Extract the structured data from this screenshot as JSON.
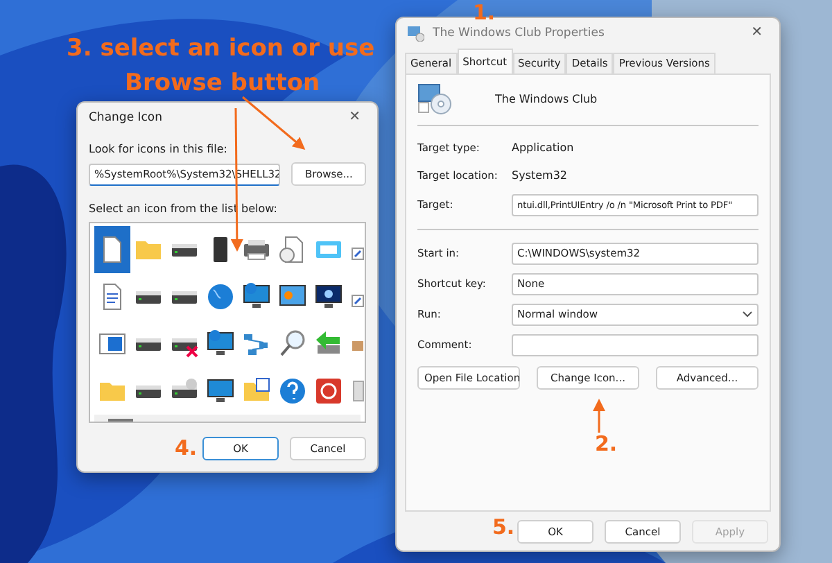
{
  "annotations": [
    {
      "text": "3. select an icon or use",
      "kind": "caption"
    },
    {
      "text": "Browse button",
      "kind": "caption"
    },
    {
      "text": "1.",
      "kind": "step"
    },
    {
      "text": "2.",
      "kind": "step"
    },
    {
      "text": "4.",
      "kind": "step"
    },
    {
      "text": "5.",
      "kind": "step"
    }
  ],
  "change_icon": {
    "title": "Change Icon",
    "close": "✕",
    "file_label": "Look for icons in this file:",
    "file_value": "%SystemRoot%\\System32\\SHELL32",
    "browse": "Browse...",
    "list_label": "Select an icon from the list below:",
    "icons": [
      {
        "selected": true
      },
      {
        "selected": false
      },
      {
        "selected": false
      },
      {
        "selected": false
      },
      {
        "selected": false
      },
      {
        "selected": false
      },
      {
        "selected": false
      },
      {
        "selected": false
      },
      {
        "selected": false
      },
      {
        "selected": false
      },
      {
        "selected": false
      },
      {
        "selected": false
      },
      {
        "selected": false
      },
      {
        "selected": false
      },
      {
        "selected": false
      },
      {
        "selected": false
      },
      {
        "selected": false
      },
      {
        "selected": false
      },
      {
        "selected": false
      },
      {
        "selected": false
      },
      {
        "selected": false
      },
      {
        "selected": false
      },
      {
        "selected": false
      },
      {
        "selected": false
      },
      {
        "selected": false
      },
      {
        "selected": false
      },
      {
        "selected": false
      },
      {
        "selected": false
      },
      {
        "selected": false
      },
      {
        "selected": false
      },
      {
        "selected": false
      },
      {
        "selected": false
      }
    ],
    "buttons": [
      {
        "label": "OK",
        "default": true
      },
      {
        "label": "Cancel",
        "default": false
      }
    ]
  },
  "properties": {
    "title": "The Windows Club Properties",
    "close": "✕",
    "tabs": [
      {
        "label": "General",
        "selected": false
      },
      {
        "label": "Shortcut",
        "selected": true
      },
      {
        "label": "Security",
        "selected": false
      },
      {
        "label": "Details",
        "selected": false
      },
      {
        "label": "Previous Versions",
        "selected": false
      }
    ],
    "shortcut_name": "The Windows Club",
    "info": [
      {
        "label": "Target type:",
        "value": "Application"
      },
      {
        "label": "Target location:",
        "value": "System32"
      }
    ],
    "target": {
      "label": "Target:",
      "value": "ntui.dll,PrintUIEntry /o /n \"Microsoft Print to PDF\""
    },
    "fields": [
      {
        "label": "Start in:",
        "value": "C:\\WINDOWS\\system32",
        "kind": "text"
      },
      {
        "label": "Shortcut key:",
        "value": "None",
        "kind": "text"
      },
      {
        "label": "Run:",
        "value": "Normal window",
        "kind": "select"
      },
      {
        "label": "Comment:",
        "kind": "text"
      }
    ],
    "actions": [
      "Open File Location",
      "Change Icon...",
      "Advanced..."
    ],
    "buttons": [
      {
        "label": "OK",
        "disabled": false
      },
      {
        "label": "Cancel",
        "disabled": false
      },
      {
        "label": "Apply",
        "disabled": true
      }
    ]
  }
}
